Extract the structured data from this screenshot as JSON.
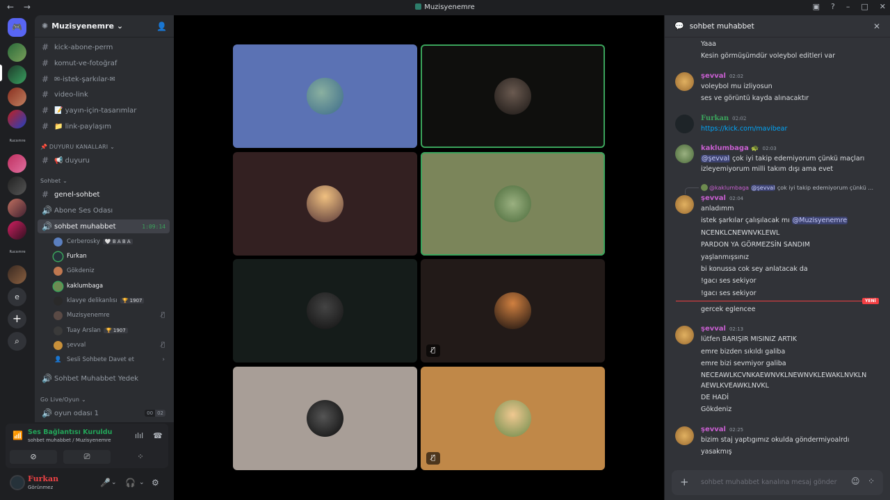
{
  "window": {
    "title": "Muzisyenemre",
    "back": "←",
    "forward": "→"
  },
  "guilds": {
    "home_icon": "discord-icon",
    "label_a": "Rucsımre",
    "label_b": "Rucsımre",
    "e_label": "e",
    "add": "+",
    "explore": "⌕"
  },
  "server": {
    "name": "Muzisyenemre",
    "channels": [
      {
        "label": "kick-abone-perm"
      },
      {
        "label": "komut-ve-fotoğraf"
      },
      {
        "label": "✉-istek-şarkılar-✉"
      },
      {
        "label": "video-link"
      },
      {
        "label": "📝 yayın-için-tasarımlar"
      },
      {
        "label": "📁 link-paylaşım"
      }
    ],
    "category_duyuru": "📌 DUYURU KANALLARI ⌄",
    "duyuru_channel": "📢 duyuru",
    "category_sohbet": "Sohbet ⌄",
    "genel": "genel-sohbet",
    "abone_voice": "Abone Ses Odası",
    "sohbet_voice": "sohbet muhabbet",
    "timer": "1:09:14",
    "voice_users": [
      {
        "name": "Cerberosky",
        "tag": "🤍 B A B A",
        "color": "#5b7fbf"
      },
      {
        "name": "Furkan",
        "tag": "",
        "color": "#26323a"
      },
      {
        "name": "Gökdeniz",
        "tag": "",
        "color": "#c07850"
      },
      {
        "name": "kaklumbaga",
        "tag": "",
        "color": "#6e8b52"
      },
      {
        "name": "klavye delikanlısı",
        "tag": "🏆 1907",
        "color": "#2a2a2a"
      },
      {
        "name": "Muzisyenemre",
        "tag": "",
        "color": "#5a4a45"
      },
      {
        "name": "Tuay Arslan",
        "tag": "🏆 1907",
        "color": "#3a3a3a"
      },
      {
        "name": "şevval",
        "tag": "",
        "color": "#c8903a"
      }
    ],
    "invite": "Sesli Sohbete Davet et",
    "yedek_voice": "Sohbet Muhabbet Yedek",
    "category_golive": "Go Live/Oyun ⌄",
    "oyun_voice": "oyun odası 1",
    "oyun_count_a": "00",
    "oyun_count_b": "02"
  },
  "voice_panel": {
    "status": "Ses Bağlantısı Kuruldu",
    "location": "sohbet muhabbet / Muzisyenemre"
  },
  "user": {
    "name": "Furkan",
    "status": "Görünmez"
  },
  "stage": {
    "tiles": [
      {
        "bg": "#5b72b4",
        "face": "#4a7c9e",
        "speaking": false,
        "muted": false
      },
      {
        "bg": "#0f0f0d",
        "face": "#2a2420",
        "speaking": true,
        "muted": false
      },
      {
        "bg": "#332021",
        "face": "#c89070",
        "speaking": false,
        "muted": false
      },
      {
        "bg": "#7b855a",
        "face": "#6e8b52",
        "speaking": true,
        "muted": false
      },
      {
        "bg": "#151c1a",
        "face": "#222",
        "speaking": false,
        "muted": false
      },
      {
        "bg": "#221a18",
        "face": "#3a2a22",
        "speaking": false,
        "muted": true
      },
      {
        "bg": "#a89e97",
        "face": "#111",
        "speaking": false,
        "muted": false
      },
      {
        "bg": "#c08848",
        "face": "#d8a060",
        "speaking": false,
        "muted": true
      }
    ]
  },
  "chat": {
    "channel": "sohbet muhabbet",
    "lines": {
      "l1": "Yaaa",
      "l2": "Kesin görmüşümdür voleybol editleri var",
      "sevval": "şevval",
      "t1": "02:02",
      "s1": "voleybol mu izliyosun",
      "s2": "ses ve görüntü kayda alınacaktır",
      "furkan": "Furkan",
      "t2": "02:02",
      "url": "https://kick.com/mavibear",
      "kak": "kaklumbaga",
      "t3": "02:03",
      "k_mention": "@şevval",
      "k1": " çok iyi takip edemiyorum çünkü maçları",
      "k2": "izleyemiyorum milli takım dışı ama evet",
      "reply_author": "@kaklumbaga",
      "reply_mention": "@şevval",
      "reply_text": " çok iyi takip edemiyorum çünkü ...",
      "t4": "02:04",
      "a1": "anladımm",
      "a2_pre": "istek şarkılar çalışılacak mı ",
      "a2_mention": "@Muzisyenemre",
      "a3": "NCENKLCNEWNVKLEWL",
      "a4": "PARDON YA GÖRMEZSİN SANDIM",
      "a5": "yaşlanmışsınız",
      "a6": "bi konussa cok sey anlatacak da",
      "a7": "!gacı ses sekiyor",
      "a8": "!gacı ses sekiyor",
      "new": "YENİ",
      "a9": "gercek eglencee",
      "t5": "02:13",
      "b1": "lütfen BARIŞIR MISINIZ ARTIK",
      "b2": "emre bizden sıkıldı galiba",
      "b3": "emre bizi sevmiyor galiba",
      "b4": "NECEAWLKCVNKAEWNVKLNEWNVKLEWAKLNVKLN",
      "b5": "AEWLKVEAWKLNVKL",
      "b6": "DE HADİ",
      "b7": "Gökdeniz",
      "t6": "02:25",
      "c1": "bizim staj yaptıgımız okulda göndermiyoalrdı",
      "c2": "yasakmış"
    },
    "placeholder": "sohbet muhabbet kanalına mesaj gönder"
  }
}
